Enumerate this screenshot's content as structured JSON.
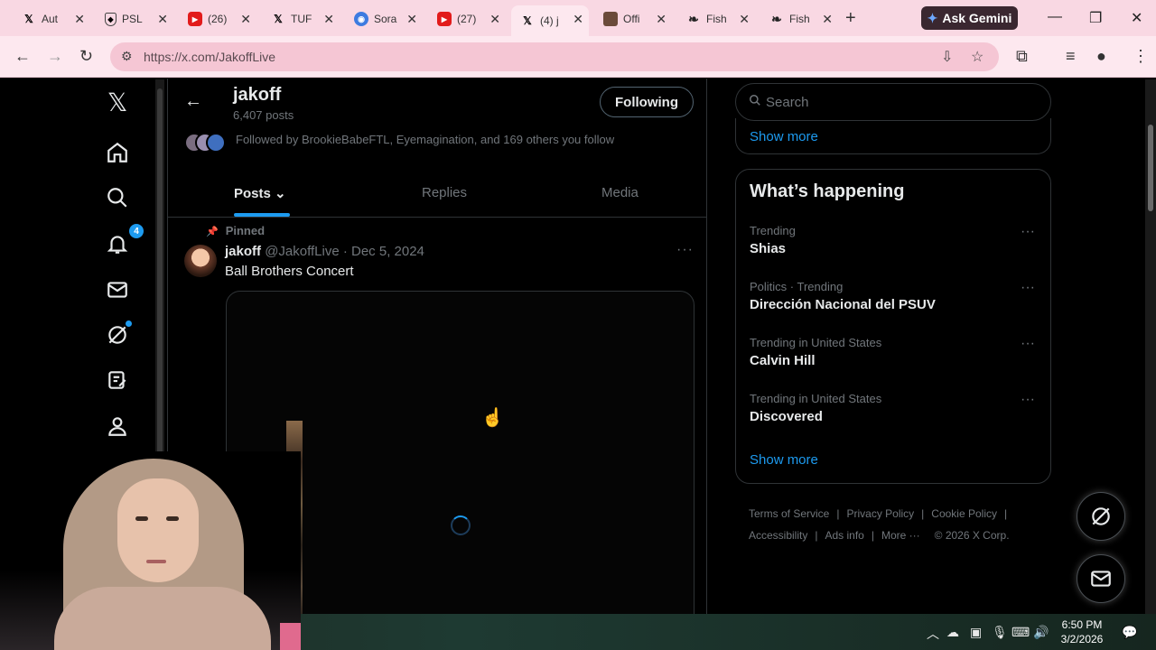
{
  "browser": {
    "tabs": [
      {
        "title": "Aut",
        "icon": "x-logo-icon"
      },
      {
        "title": "PSL",
        "icon": "shield-icon"
      },
      {
        "title": "(26)",
        "icon": "youtube-icon"
      },
      {
        "title": "TUF",
        "icon": "x-logo-icon"
      },
      {
        "title": "Sora",
        "icon": "sora-icon"
      },
      {
        "title": "(27)",
        "icon": "youtube-icon"
      },
      {
        "title": "(4) j",
        "icon": "x-logo-icon"
      },
      {
        "title": "Offi",
        "icon": "image-icon"
      },
      {
        "title": "Fish",
        "icon": "fish-icon"
      },
      {
        "title": "Fish",
        "icon": "fish-icon"
      }
    ],
    "gemini_label": "Ask Gemini",
    "url": "https://x.com/JakoffLive"
  },
  "profile": {
    "name": "jakoff",
    "posts_count": "6,407 posts",
    "follow_label": "Following",
    "followed_by": "Followed by BrookieBabeFTL, Eyemagination, and 169 others you follow"
  },
  "tabs": {
    "posts": "Posts",
    "replies": "Replies",
    "media": "Media"
  },
  "tweet": {
    "pinned_label": "Pinned",
    "author_name": "jakoff",
    "handle_date": "@JakoffLive · Dec 5, 2024",
    "text": "Ball Brothers Concert"
  },
  "sidebar": {
    "search_placeholder": "Search",
    "show_more_top": "Show more",
    "happening_title": "What’s happening",
    "trends": [
      {
        "meta": "Trending",
        "topic": "Shias"
      },
      {
        "meta": "Politics · Trending",
        "topic": "Dirección Nacional del PSUV"
      },
      {
        "meta": "Trending in United States",
        "topic": "Calvin Hill"
      },
      {
        "meta": "Trending in United States",
        "topic": "Discovered"
      }
    ],
    "show_more": "Show more",
    "footer": {
      "terms": "Terms of Service",
      "privacy": "Privacy Policy",
      "cookie": "Cookie Policy",
      "accessibility": "Accessibility",
      "ads": "Ads info",
      "more": "More ···",
      "copyright": "© 2026 X Corp."
    }
  },
  "nav": {
    "notifications_badge": "4"
  },
  "taskbar": {
    "time": "6:50 PM",
    "date": "3/2/2026"
  },
  "colors": {
    "accent": "#1d9bf0",
    "chrome_bg": "#f9d8e3"
  }
}
